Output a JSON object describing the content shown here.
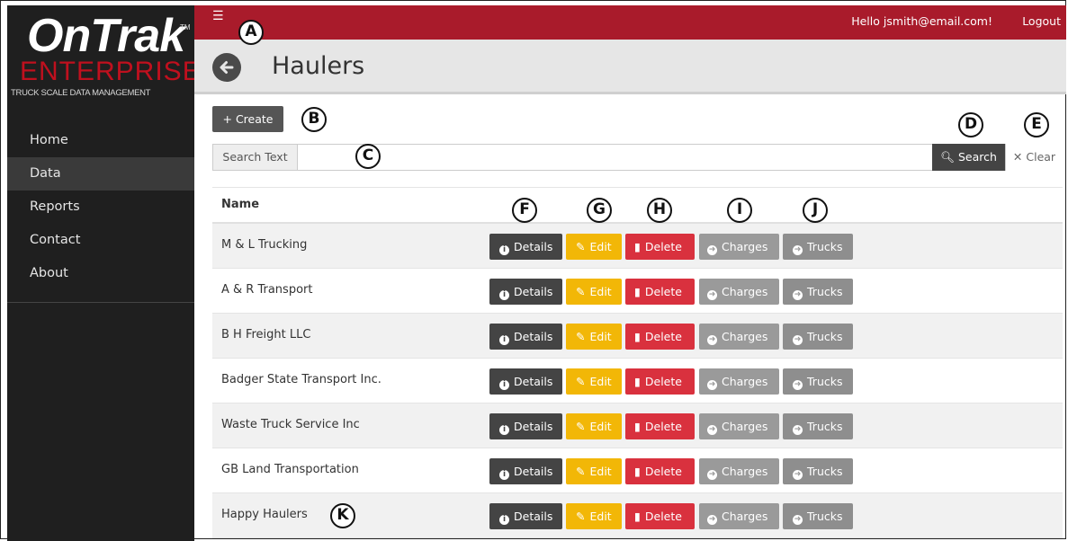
{
  "brand": {
    "logo_main": "OnTrak",
    "logo_tm": "TM",
    "logo_enterprise": "ENTERPRISE",
    "logo_tagline": "TRUCK SCALE DATA MANAGEMENT"
  },
  "sidebar": {
    "items": [
      {
        "label": "Home",
        "active": false
      },
      {
        "label": "Data",
        "active": true
      },
      {
        "label": "Reports",
        "active": false
      },
      {
        "label": "Contact",
        "active": false
      },
      {
        "label": "About",
        "active": false
      }
    ]
  },
  "topbar": {
    "menu_icon": "hamburger-icon",
    "greeting": "Hello jsmith@email.com!",
    "logout": "Logout",
    "color": "#a91b2b"
  },
  "page": {
    "title": "Haulers",
    "back_icon": "arrow-left-circle-icon"
  },
  "toolbar": {
    "create_label": "+ Create",
    "search_label": "Search Text",
    "search_value": "",
    "search_button": "Search",
    "clear_button": "Clear"
  },
  "table": {
    "header_name": "Name",
    "action_labels": {
      "details": "Details",
      "edit": "Edit",
      "delete": "Delete",
      "charges": "Charges",
      "trucks": "Trucks"
    },
    "rows": [
      {
        "name": "M & L Trucking"
      },
      {
        "name": "A & R Transport"
      },
      {
        "name": "B H Freight LLC"
      },
      {
        "name": "Badger State Transport Inc."
      },
      {
        "name": "Waste Truck Service Inc"
      },
      {
        "name": "GB Land Transportation"
      },
      {
        "name": "Happy Haulers"
      }
    ]
  },
  "callouts": [
    "A",
    "B",
    "C",
    "D",
    "E",
    "F",
    "G",
    "H",
    "I",
    "J",
    "K"
  ],
  "colors": {
    "details": "#444444",
    "edit": "#f2b707",
    "delete": "#d9313e",
    "charges": "#9a9a9a",
    "trucks": "#8e8e8e"
  }
}
